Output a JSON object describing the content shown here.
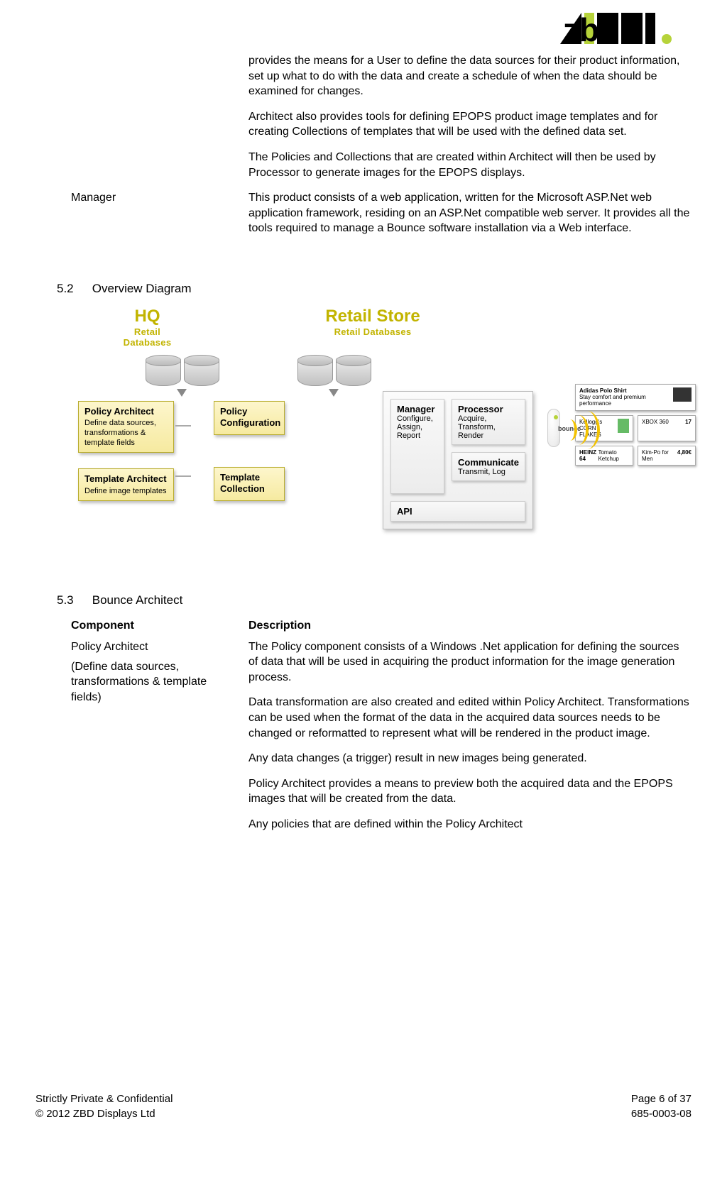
{
  "logo_alt": "zbd.",
  "topTable": {
    "rows": [
      {
        "label": "",
        "paras": [
          "provides the means for a User to define the data sources for their product information, set up what to do with the data and create a schedule of when the data should be examined for changes.",
          "Architect also provides tools for defining EPOPS product image templates and for creating Collections of templates that will be used with the defined data set.",
          "The Policies and Collections that are created within Architect will then be used by Processor to generate images for the EPOPS displays."
        ]
      },
      {
        "label": "Manager",
        "paras": [
          "This product consists of a web application, written for the Microsoft ASP.Net web application framework, residing on an ASP.Net compatible web server. It provides all the tools required to manage a Bounce software installation via a Web interface."
        ]
      }
    ]
  },
  "section52": {
    "num": "5.2",
    "title": "Overview Diagram"
  },
  "diagram": {
    "hq": {
      "big": "HQ",
      "small": "Retail Databases"
    },
    "retail": {
      "big": "Retail Store",
      "small": "Retail Databases"
    },
    "policyArchitect": {
      "title": "Policy Architect",
      "sub": "Define data sources, transformations & template fields"
    },
    "templateArchitect": {
      "title": "Template Architect",
      "sub": "Define image templates"
    },
    "policyConfig": {
      "title": "Policy Configuration"
    },
    "templateCollection": {
      "title": "Template Collection"
    },
    "manager": {
      "title": "Manager",
      "sub": "Configure, Assign, Report"
    },
    "processor": {
      "title": "Processor",
      "sub": "Acquire, Transform, Render"
    },
    "communicate": {
      "title": "Communicate",
      "sub": "Transmit, Log"
    },
    "api": {
      "title": "API"
    },
    "device": "bounce",
    "labels": {
      "l1": {
        "name": "Adidas Polo Shirt",
        "note": "Stay comfort and premium performance"
      },
      "l2": {
        "name": "Kellogg's CORN FLAKES"
      },
      "l3": {
        "name": "XBOX 360",
        "price": "17"
      },
      "l4": {
        "name": "HEINZ 64",
        "sub": "Tomato Ketchup"
      },
      "l5": {
        "name": "Kim-Po for Men",
        "price": "4,80€"
      }
    }
  },
  "section53": {
    "num": "5.3",
    "title": "Bounce Architect"
  },
  "bottomTable": {
    "head": {
      "left": "Component",
      "right": "Description"
    },
    "rows": [
      {
        "label": "Policy Architect",
        "labelSub": "(Define data sources, transformations & template fields)",
        "paras": [
          "The Policy component consists of a Windows .Net application for defining the sources of data that will be used in acquiring the product information for the image generation process.",
          "Data transformation are also created and edited within Policy Architect. Transformations can be used when the format of the data in the acquired data sources needs to be changed or reformatted to represent what will be rendered in the product image.",
          "Any data changes (a trigger) result in new images being generated.",
          "Policy Architect provides a means to preview both the acquired data and the EPOPS images that will be created from the data.",
          "Any policies that are defined within the Policy Architect"
        ]
      }
    ]
  },
  "footer": {
    "left1": "Strictly Private & Confidential",
    "left2": "© 2012 ZBD Displays Ltd",
    "right1": "Page 6 of 37",
    "right2": "685-0003-08"
  }
}
